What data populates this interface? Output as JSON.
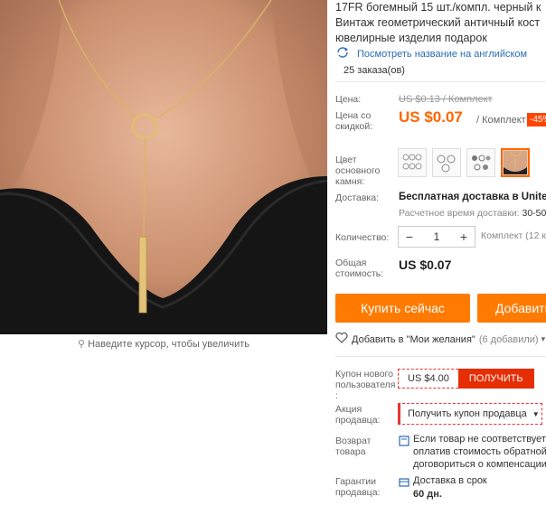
{
  "product": {
    "title_lines": [
      "17FR богемный 15 шт./компл. черный к",
      "Винтаж геометрический античный кост",
      "ювелирные изделия подарок"
    ],
    "translate_link": "Посмотреть название на английском",
    "orders": "25 заказа(ов)",
    "zoom_hint": "Наведите курсор, чтобы увеличить"
  },
  "pricing": {
    "price_label": "Цена:",
    "old_price": "US $0.13 / Комплект",
    "discount_label_lines": [
      "Цена со",
      "скидкой:"
    ],
    "current_price": "US $0.07",
    "unit": "/ Комплект",
    "discount": "-45%"
  },
  "variants": {
    "label_lines": [
      "Цвет",
      "основного",
      "камня:"
    ],
    "swatch_icons": [
      "earring-set-1-icon",
      "earring-set-2-icon",
      "earring-set-3-icon",
      "necklace-photo-icon"
    ],
    "selected_index": 3
  },
  "shipping": {
    "label": "Доставка:",
    "value": "Бесплатная доставка в United St",
    "time_label": "Расчетное время доставки:",
    "time_value": "30-50"
  },
  "quantity": {
    "label": "Количество:",
    "minus": "−",
    "value": "1",
    "plus": "+",
    "available": "Комплект (12 ко"
  },
  "total": {
    "label_lines": [
      "Общая",
      "стоимость:"
    ],
    "value": "US $0.07"
  },
  "actions": {
    "buy_now": "Купить сейчас",
    "add_to_cart": "Добавить"
  },
  "wishlist": {
    "label": "Добавить в \"Мои желания\"",
    "count": "(6 добавили)",
    "arrow": "▾"
  },
  "coupons": {
    "new_user_label_lines": [
      "Купон нового",
      "пользователя",
      ":"
    ],
    "new_user_value": "US $4.00",
    "new_user_button": "ПОЛУЧИТЬ",
    "seller_label_lines": [
      "Акция",
      "продавца:"
    ],
    "seller_button": "Получить купон продавца",
    "seller_arrow": "▼"
  },
  "returns": {
    "label_lines": [
      "Возврат",
      "товара"
    ],
    "text_lines": [
      "Если товар не соответствует о",
      "оплатив стоимость обратной п",
      "договориться о компенсации с"
    ]
  },
  "guarantee": {
    "label_lines": [
      "Гарантии",
      "продавца:"
    ],
    "text": "Доставка в срок",
    "days": "60 дн."
  },
  "colors": {
    "accent": "#ff7a00",
    "price": "#ff6600",
    "coupon_red": "#e62e04",
    "link": "#2a6bb5"
  }
}
